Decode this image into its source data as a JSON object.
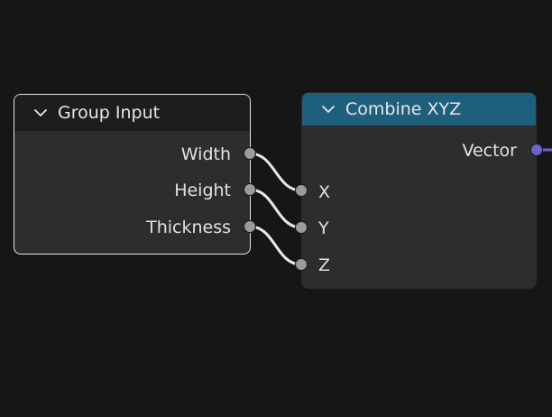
{
  "nodes": {
    "group_input": {
      "title": "Group Input",
      "outputs": [
        "Width",
        "Height",
        "Thickness"
      ]
    },
    "combine_xyz": {
      "title": "Combine XYZ",
      "outputs": [
        "Vector"
      ],
      "inputs": [
        "X",
        "Y",
        "Z"
      ]
    }
  },
  "colors": {
    "canvas": "#161616",
    "node_body": "#2d2d2d",
    "group_input_header": "#1d1d1d",
    "combine_header": "#1f5f7e",
    "float_socket": "#9b9b9b",
    "vector_socket": "#6a63cf",
    "link": "#e8e8e8",
    "selected_outline": "#e4e4e4"
  },
  "icons": {
    "collapse": "chevron-down-icon"
  }
}
